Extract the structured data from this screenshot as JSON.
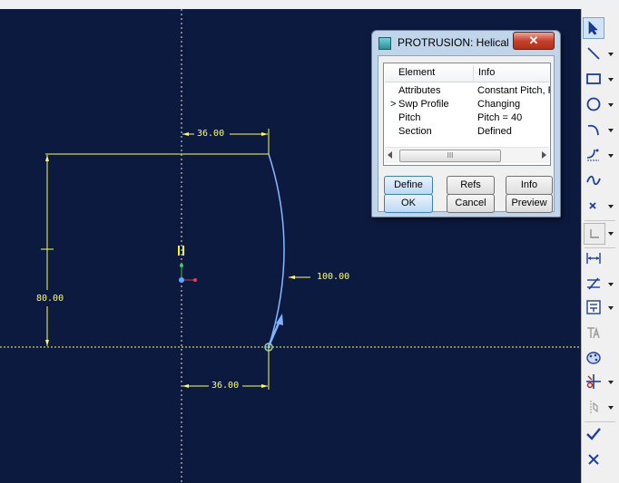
{
  "dialog": {
    "title": "PROTRUSION: Helical ...",
    "close_label": "✕",
    "columns": {
      "element": "Element",
      "info": "Info"
    },
    "rows": [
      {
        "marker": "",
        "element": "Attributes",
        "info": "Constant Pitch, F"
      },
      {
        "marker": ">",
        "element": "Swp Profile",
        "info": "Changing"
      },
      {
        "marker": "",
        "element": "Pitch",
        "info": "Pitch = 40"
      },
      {
        "marker": "",
        "element": "Section",
        "info": "Defined"
      }
    ],
    "scroll_thumb_label": "III",
    "buttons": {
      "define": "Define",
      "refs": "Refs",
      "info": "Info",
      "ok": "OK",
      "cancel": "Cancel",
      "preview": "Preview"
    }
  },
  "sketch": {
    "dim_top_width": "36.00",
    "dim_bottom_width": "36.00",
    "dim_height": "80.00",
    "dim_radius": "100.00",
    "colors": {
      "background": "#0d1a40",
      "dimension": "#ffff55",
      "geometry": "#8ab8ff",
      "centerline": "#f2f2c8"
    }
  },
  "toolbar": {
    "tools": [
      {
        "icon": "select-arrow-icon",
        "has_menu": false
      },
      {
        "icon": "line-icon",
        "has_menu": true
      },
      {
        "icon": "rectangle-icon",
        "has_menu": true
      },
      {
        "icon": "circle-icon",
        "has_menu": true
      },
      {
        "icon": "arc-icon",
        "has_menu": true
      },
      {
        "icon": "fillet-icon",
        "has_menu": true
      },
      {
        "icon": "spline-icon",
        "has_menu": false
      },
      {
        "icon": "point-icon",
        "has_menu": true
      },
      {
        "icon": "use-edge-icon",
        "has_menu": true
      },
      {
        "icon": "dimension-icon",
        "has_menu": false
      },
      {
        "icon": "modify-icon",
        "has_menu": true
      },
      {
        "icon": "constraint-icon",
        "has_menu": true
      },
      {
        "icon": "text-icon",
        "has_menu": false
      },
      {
        "icon": "palette-icon",
        "has_menu": false
      },
      {
        "icon": "trim-icon",
        "has_menu": true
      },
      {
        "icon": "mirror-icon",
        "has_menu": true
      },
      {
        "icon": "accept-check-icon",
        "has_menu": false
      },
      {
        "icon": "cancel-x-icon",
        "has_menu": false
      }
    ]
  }
}
